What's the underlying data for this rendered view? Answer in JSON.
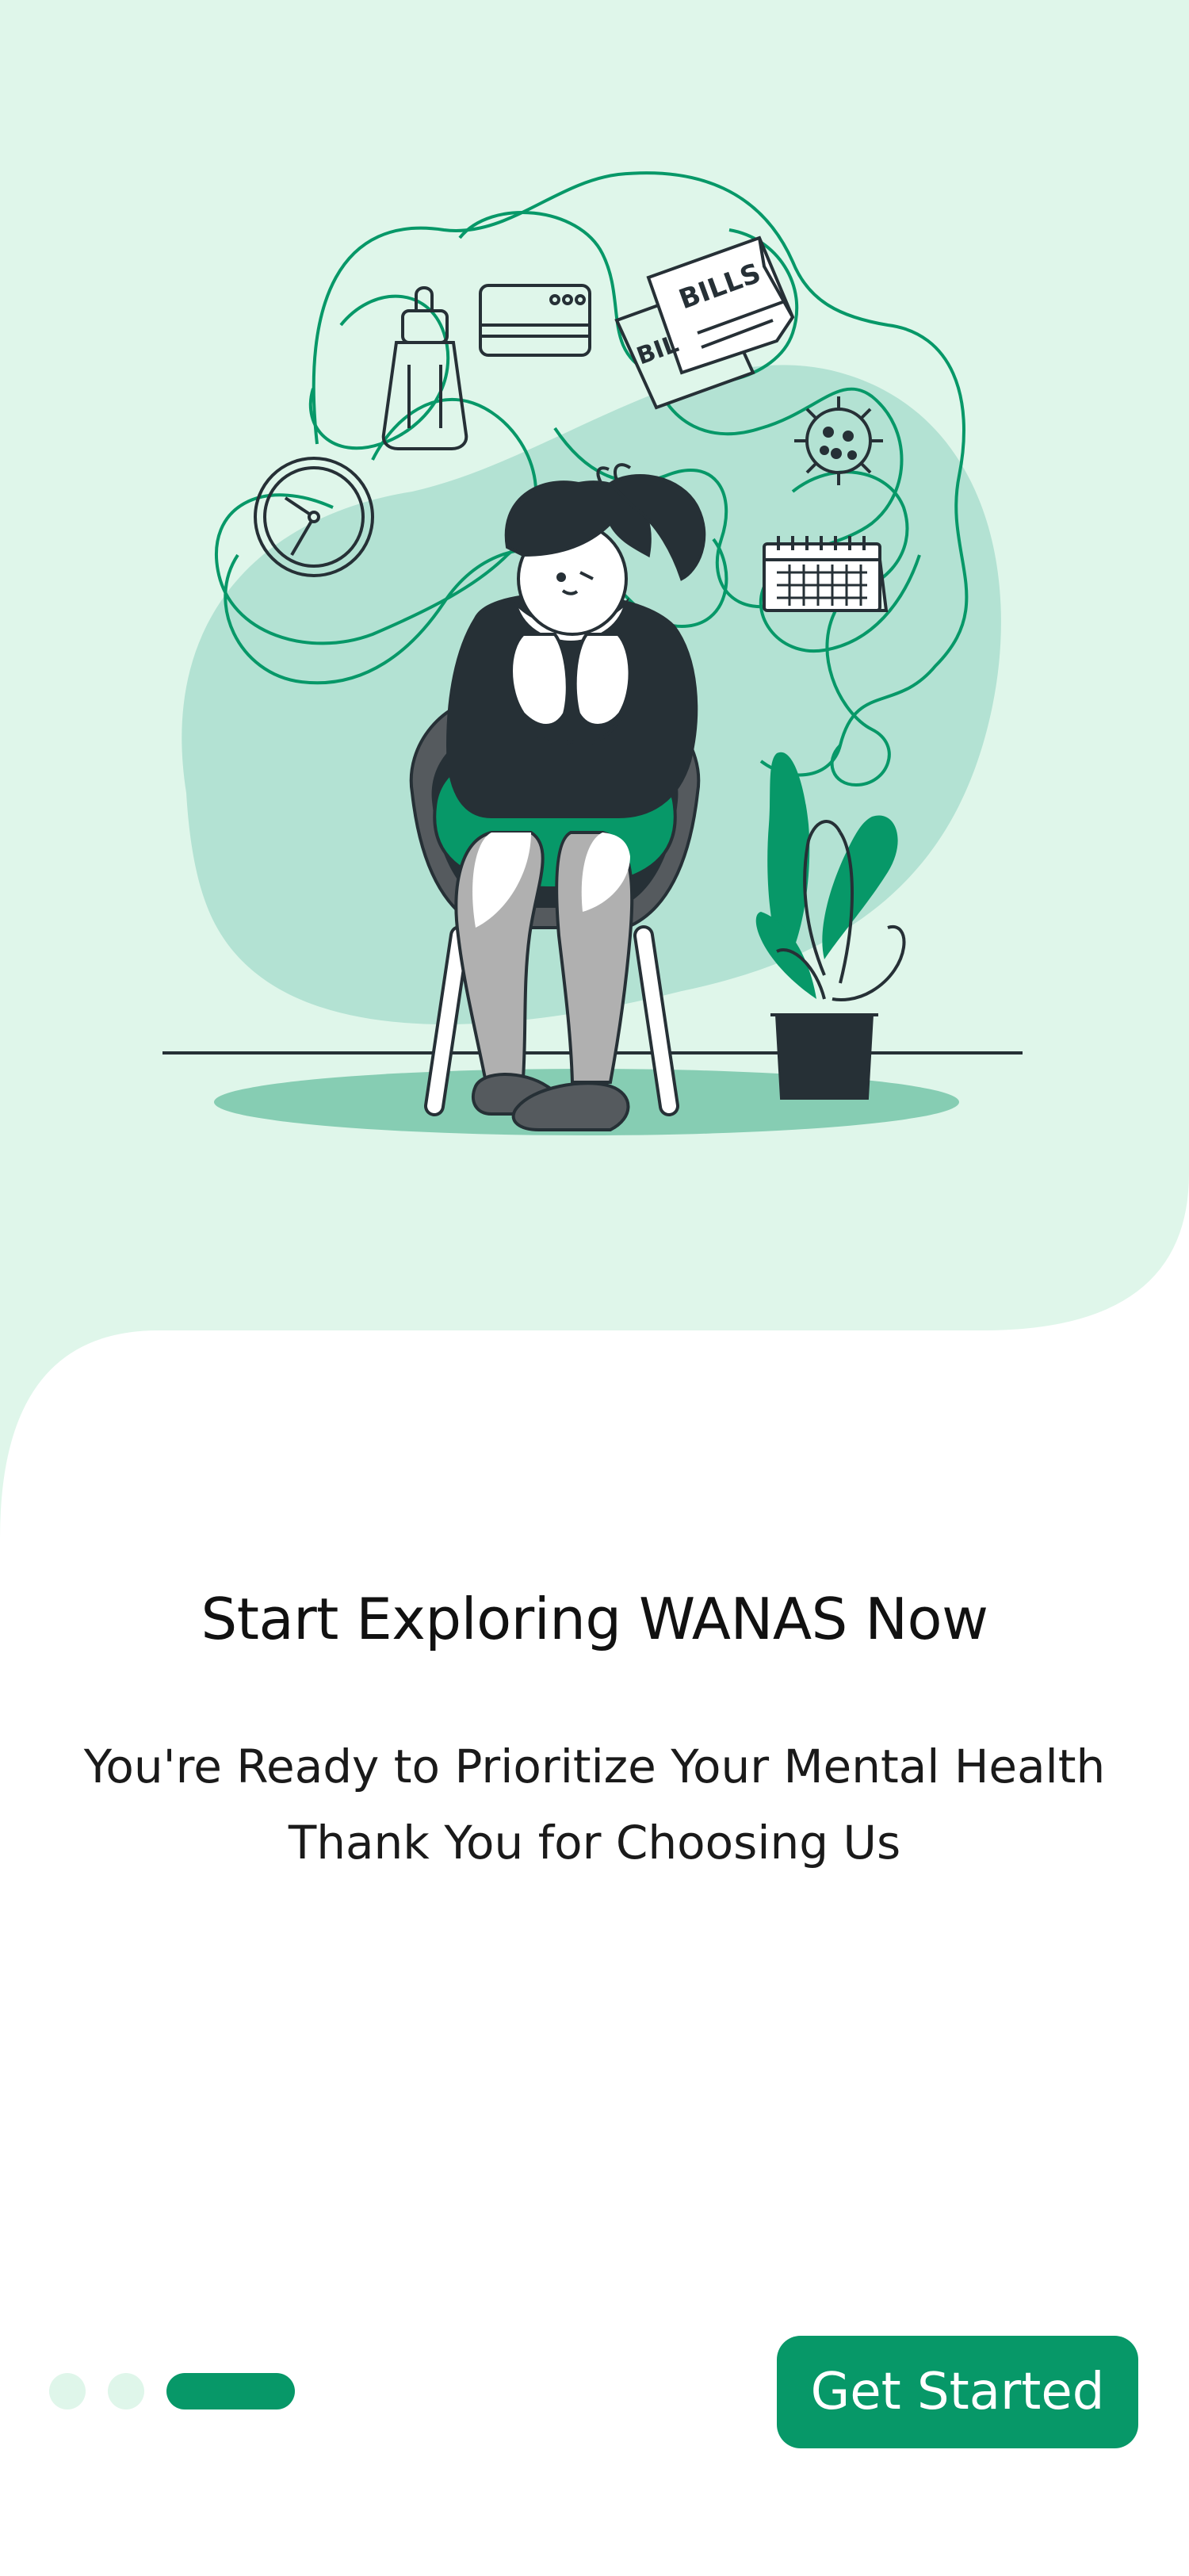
{
  "onboarding": {
    "title": "Start Exploring WANAS Now",
    "subtitle_line1": "You're Ready to Prioritize Your Mental Health",
    "subtitle_line2": "Thank You for Choosing Us",
    "cta_label": "Get Started",
    "illustration": {
      "bill_text_front": "BILLS",
      "bill_text_back": "BIL"
    }
  },
  "pager": {
    "total_pages": 3,
    "active_page": 3
  },
  "colors": {
    "accent": "#079868",
    "hero_background": "#DFF6EA",
    "blob": "#B3E2D3",
    "dark": "#263036"
  }
}
